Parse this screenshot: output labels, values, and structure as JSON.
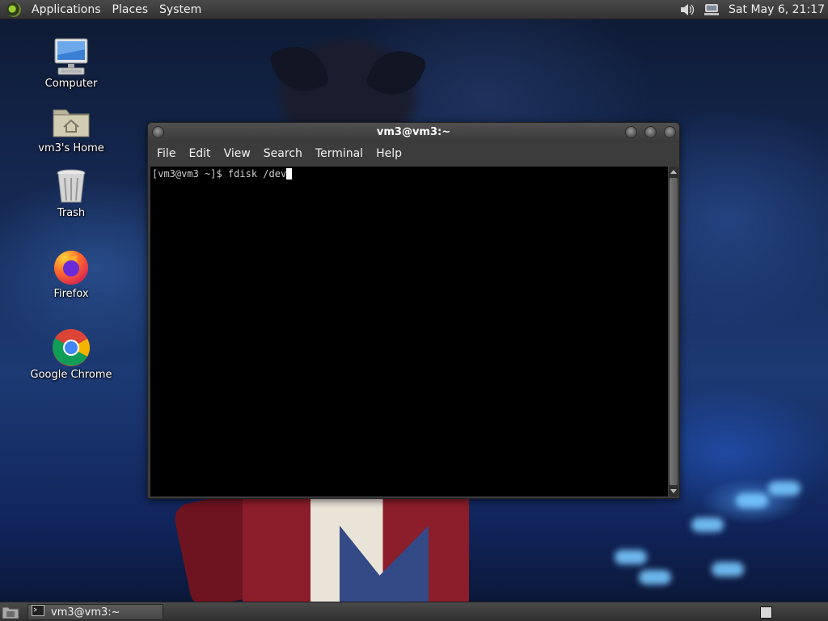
{
  "top_panel": {
    "menus": [
      "Applications",
      "Places",
      "System"
    ],
    "tray_icons": [
      "volume-icon",
      "network-icon"
    ],
    "clock": "Sat May  6, 21:17"
  },
  "desktop": {
    "icons": [
      {
        "label": "Computer",
        "icon": "computer-icon"
      },
      {
        "label": "vm3's Home",
        "icon": "home-folder-icon"
      },
      {
        "label": "Trash",
        "icon": "trash-icon"
      },
      {
        "label": "Firefox",
        "icon": "firefox-icon"
      },
      {
        "label": "Google Chrome",
        "icon": "chrome-icon"
      }
    ]
  },
  "terminal": {
    "title": "vm3@vm3:~",
    "menus": [
      "File",
      "Edit",
      "View",
      "Search",
      "Terminal",
      "Help"
    ],
    "prompt_line": "[vm3@vm3 ~]$ fdisk /dev"
  },
  "bottom_panel": {
    "task_label": "vm3@vm3:~"
  },
  "colors": {
    "panel": "#3a3a3a",
    "terminal_bg": "#000000",
    "terminal_text": "#cfcfcf"
  }
}
